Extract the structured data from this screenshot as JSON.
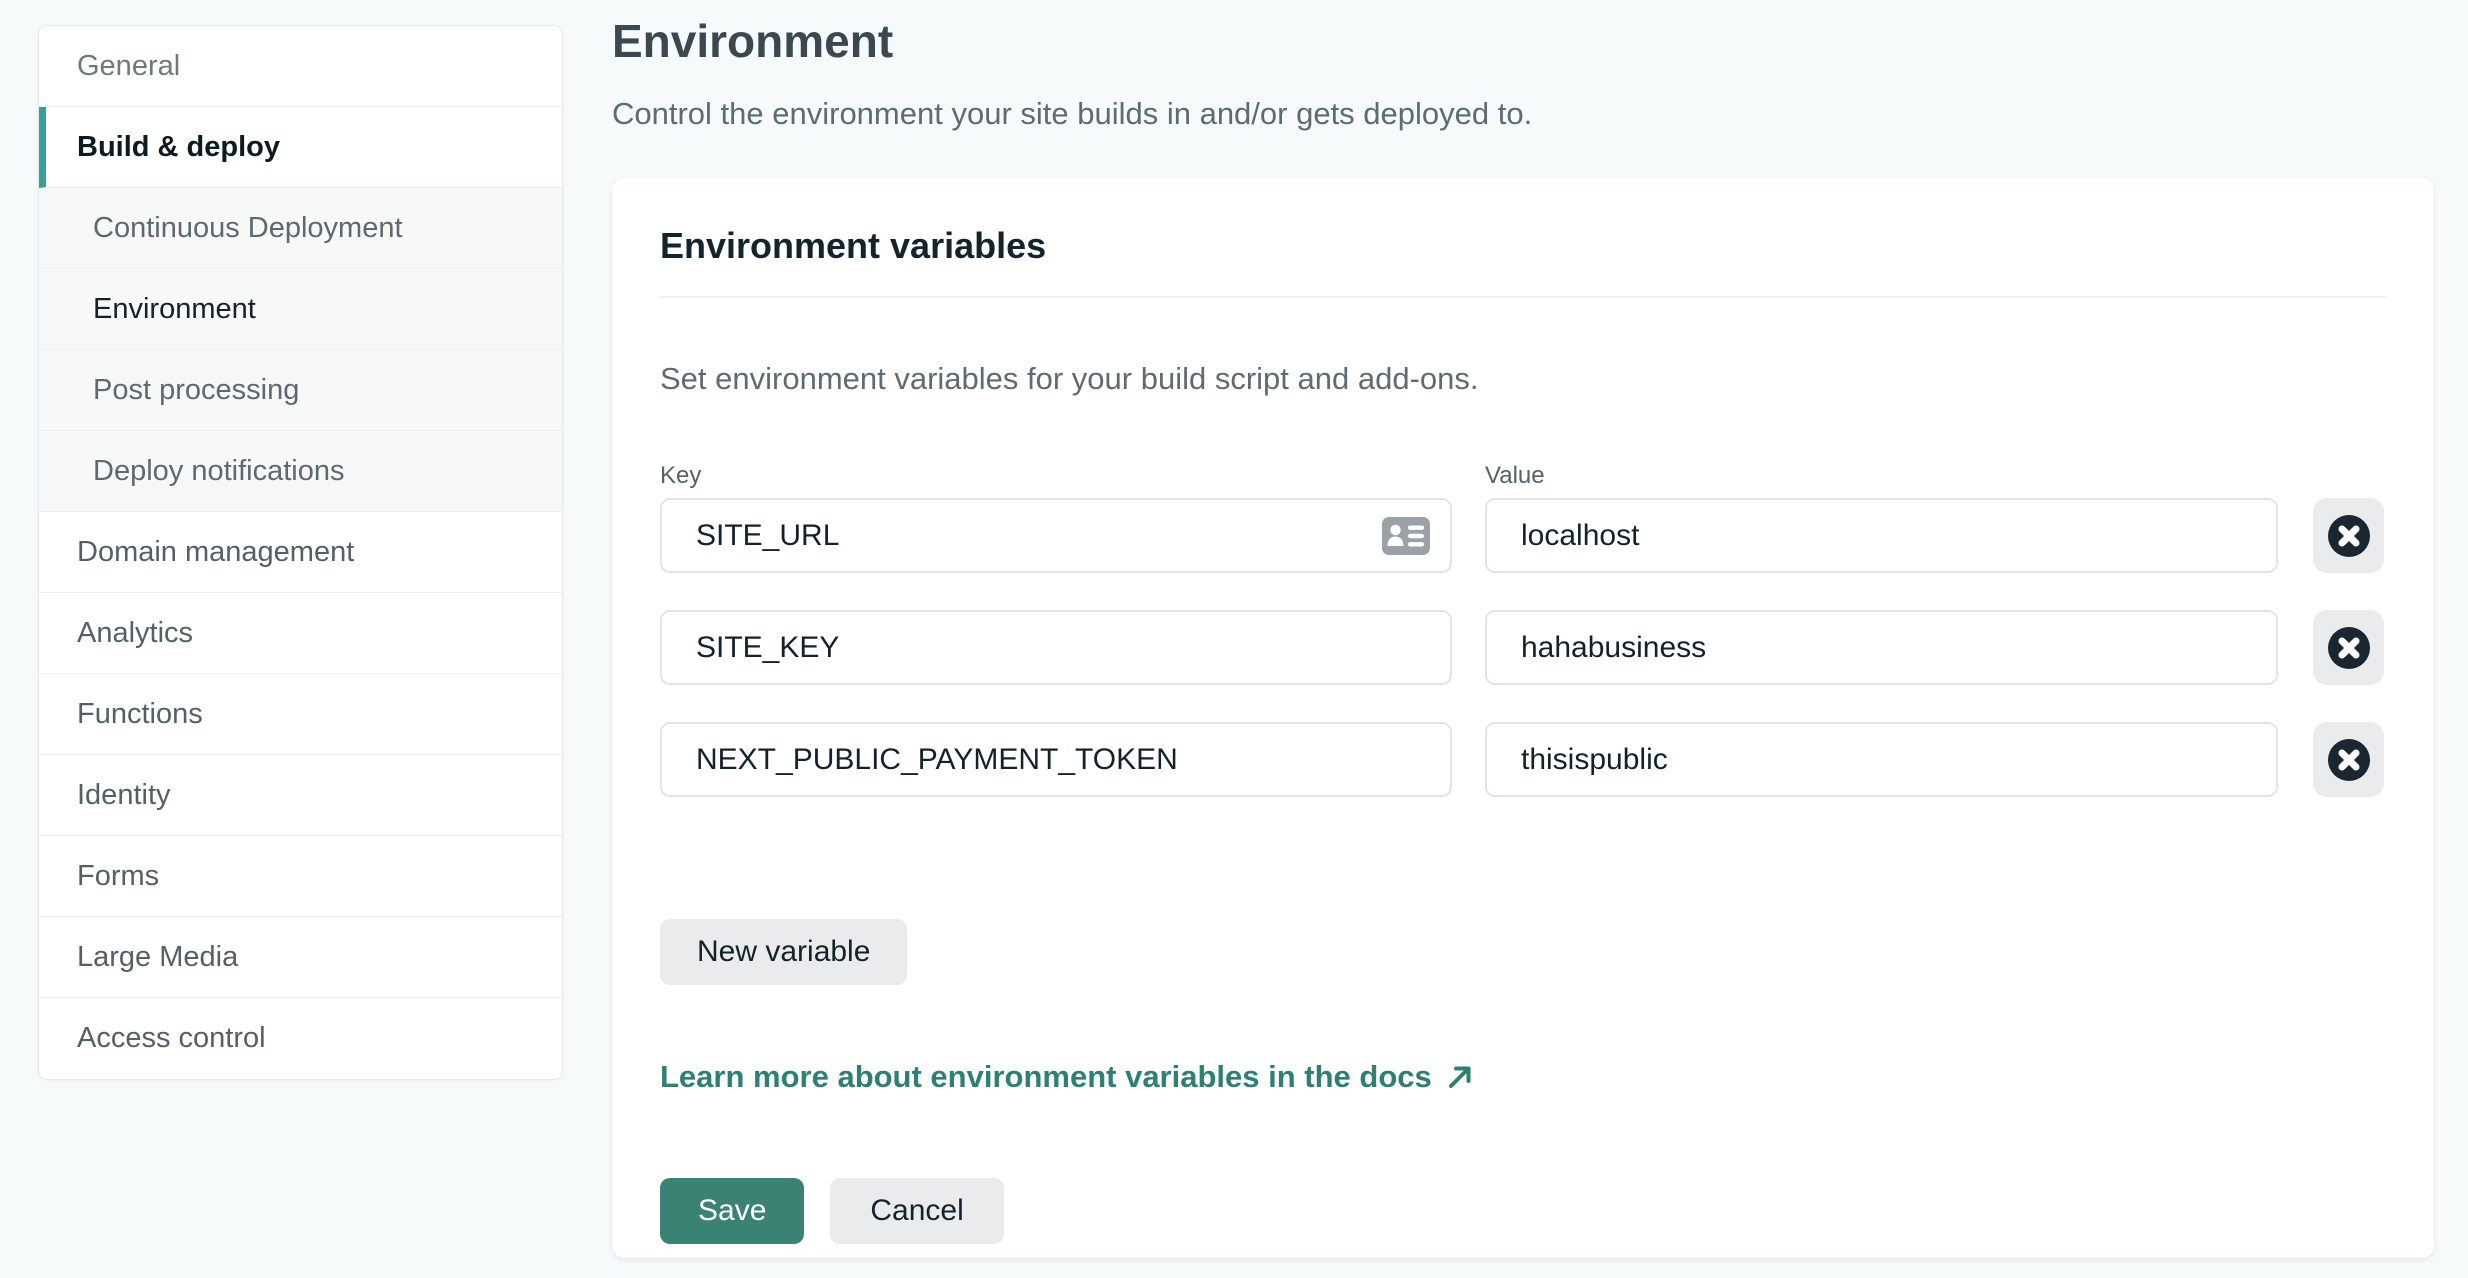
{
  "page": {
    "title": "Environment",
    "subtitle": "Control the environment your site builds in and/or gets deployed to."
  },
  "sidebar": {
    "items": [
      {
        "label": "General",
        "level": "top",
        "state": "default"
      },
      {
        "label": "Build & deploy",
        "level": "top",
        "state": "active"
      },
      {
        "label": "Continuous Deployment",
        "level": "sub",
        "state": "default"
      },
      {
        "label": "Environment",
        "level": "sub",
        "state": "current"
      },
      {
        "label": "Post processing",
        "level": "sub",
        "state": "default"
      },
      {
        "label": "Deploy notifications",
        "level": "sub",
        "state": "default"
      },
      {
        "label": "Domain management",
        "level": "top",
        "state": "default"
      },
      {
        "label": "Analytics",
        "level": "top",
        "state": "default"
      },
      {
        "label": "Functions",
        "level": "top",
        "state": "default"
      },
      {
        "label": "Identity",
        "level": "top",
        "state": "default"
      },
      {
        "label": "Forms",
        "level": "top",
        "state": "default"
      },
      {
        "label": "Large Media",
        "level": "top",
        "state": "default"
      },
      {
        "label": "Access control",
        "level": "top",
        "state": "default"
      }
    ]
  },
  "card": {
    "heading": "Environment variables",
    "description": "Set environment variables for your build script and add-ons.",
    "key_label": "Key",
    "value_label": "Value",
    "variables": [
      {
        "key": "SITE_URL",
        "value": "localhost"
      },
      {
        "key": "SITE_KEY",
        "value": "hahabusiness"
      },
      {
        "key": "NEXT_PUBLIC_PAYMENT_TOKEN",
        "value": "thisispublic"
      }
    ],
    "new_variable_label": "New variable",
    "docs_link_label": "Learn more about environment variables in the docs",
    "save_label": "Save",
    "cancel_label": "Cancel"
  },
  "icons": {
    "autofill": "contact-card",
    "delete": "circle-x",
    "docs_link": "arrow-up-right"
  },
  "colors": {
    "page_background": "#f6fafb",
    "card_background": "#ffffff",
    "active_accent_bar": "#35a093",
    "save_button": "#3a8274",
    "link_text": "#2e7f74",
    "muted_button": "#e9ebec",
    "dark_text": "#0e1e25",
    "gray_text": "#5f6b72",
    "input_border": "#e2e5e6"
  }
}
